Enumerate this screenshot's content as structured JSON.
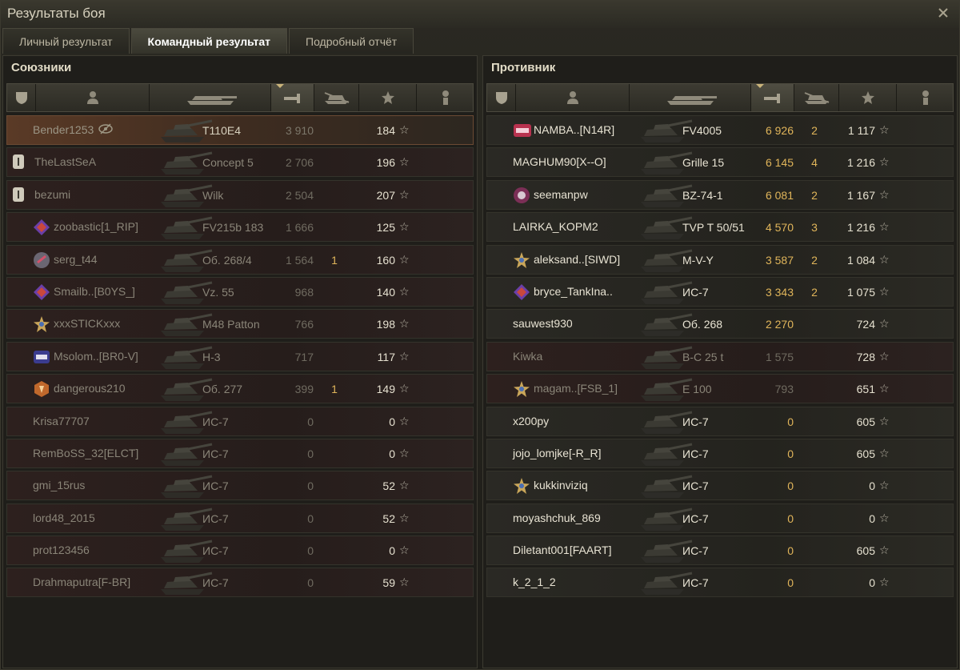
{
  "window": {
    "title": "Результаты боя"
  },
  "tabs": [
    {
      "label": "Личный результат",
      "active": false
    },
    {
      "label": "Командный результат",
      "active": true
    },
    {
      "label": "Подробный отчёт",
      "active": false
    }
  ],
  "allies": {
    "title": "Союзники",
    "rows": [
      {
        "name": "Bender1253",
        "vehicle": "T110E4",
        "damage": "3 910",
        "kills": "",
        "xp": "184",
        "state": "me",
        "badge": "none",
        "vision_icon": true
      },
      {
        "name": "TheLastSeA",
        "vehicle": "Concept 5",
        "damage": "2 706",
        "kills": "",
        "xp": "196",
        "state": "dead",
        "badge": "platoon"
      },
      {
        "name": "bezumi",
        "vehicle": "Wilk",
        "damage": "2 504",
        "kills": "",
        "xp": "207",
        "state": "dead",
        "badge": "platoon"
      },
      {
        "name": "zoobastic[1_RIP]",
        "vehicle": "FV215b 183",
        "damage": "1 666",
        "kills": "",
        "xp": "125",
        "state": "dead",
        "badge": "clan-purple"
      },
      {
        "name": "serg_t44",
        "vehicle": "Об. 268/4",
        "damage": "1 564",
        "kills": "1",
        "xp": "160",
        "state": "dead",
        "badge": "clan-gray"
      },
      {
        "name": "Smailb..[B0YS_]",
        "vehicle": "Vz. 55",
        "damage": "968",
        "kills": "",
        "xp": "140",
        "state": "dead",
        "badge": "clan-purple"
      },
      {
        "name": "xxxSTICKxxx",
        "vehicle": "M48 Patton",
        "damage": "766",
        "kills": "",
        "xp": "198",
        "state": "dead",
        "badge": "clan-star"
      },
      {
        "name": "Msolom..[BR0-V]",
        "vehicle": "Н-3",
        "damage": "717",
        "kills": "",
        "xp": "117",
        "state": "dead",
        "badge": "clan-jove"
      },
      {
        "name": "dangerous210",
        "vehicle": "Об. 277",
        "damage": "399",
        "kills": "1",
        "xp": "149",
        "state": "dead",
        "badge": "clan-orange"
      },
      {
        "name": "Krisa77707",
        "vehicle": "ИС-7",
        "damage": "0",
        "kills": "",
        "xp": "0",
        "state": "dead",
        "badge": "none"
      },
      {
        "name": "RemBoSS_32[ELCT]",
        "vehicle": "ИС-7",
        "damage": "0",
        "kills": "",
        "xp": "0",
        "state": "dead",
        "badge": "none"
      },
      {
        "name": "gmi_15rus",
        "vehicle": "ИС-7",
        "damage": "0",
        "kills": "",
        "xp": "52",
        "state": "dead",
        "badge": "none"
      },
      {
        "name": "lord48_2015",
        "vehicle": "ИС-7",
        "damage": "0",
        "kills": "",
        "xp": "52",
        "state": "dead",
        "badge": "none"
      },
      {
        "name": "prot123456",
        "vehicle": "ИС-7",
        "damage": "0",
        "kills": "",
        "xp": "0",
        "state": "dead",
        "badge": "none"
      },
      {
        "name": "Drahmaputra[F-BR]",
        "vehicle": "ИС-7",
        "damage": "0",
        "kills": "",
        "xp": "59",
        "state": "dead",
        "badge": "none"
      }
    ]
  },
  "enemies": {
    "title": "Противник",
    "rows": [
      {
        "name": "NAMBA..[N14R]",
        "vehicle": "FV4005",
        "damage": "6 926",
        "kills": "2",
        "xp": "1 117",
        "state": "alive",
        "badge": "clan-nerf"
      },
      {
        "name": "MAGHUM90[X--O]",
        "vehicle": "Grille 15",
        "damage": "6 145",
        "kills": "4",
        "xp": "1 216",
        "state": "alive",
        "badge": "none"
      },
      {
        "name": "seemanpw",
        "vehicle": "BZ-74-1",
        "damage": "6 081",
        "kills": "2",
        "xp": "1 167",
        "state": "alive",
        "badge": "clan-pink"
      },
      {
        "name": "LAIRKA_KOPM2",
        "vehicle": "TVP T 50/51",
        "damage": "4 570",
        "kills": "3",
        "xp": "1 216",
        "state": "alive",
        "badge": "none"
      },
      {
        "name": "aleksand..[SIWD]",
        "vehicle": "M-V-Y",
        "damage": "3 587",
        "kills": "2",
        "xp": "1 084",
        "state": "alive",
        "badge": "clan-star"
      },
      {
        "name": "bryce_TankIna..",
        "vehicle": "ИС-7",
        "damage": "3 343",
        "kills": "2",
        "xp": "1 075",
        "state": "alive",
        "badge": "clan-purple"
      },
      {
        "name": "sauwest930",
        "vehicle": "Об. 268",
        "damage": "2 270",
        "kills": "",
        "xp": "724",
        "state": "alive",
        "badge": "none"
      },
      {
        "name": "Kiwka",
        "vehicle": "B-C 25 t",
        "damage": "1 575",
        "kills": "",
        "xp": "728",
        "state": "dead",
        "badge": "none"
      },
      {
        "name": "magam..[FSB_1]",
        "vehicle": "E 100",
        "damage": "793",
        "kills": "",
        "xp": "651",
        "state": "dead",
        "badge": "clan-star"
      },
      {
        "name": "x200py",
        "vehicle": "ИС-7",
        "damage": "0",
        "kills": "",
        "xp": "605",
        "state": "alive",
        "badge": "none"
      },
      {
        "name": "jojo_lomjke[-R_R]",
        "vehicle": "ИС-7",
        "damage": "0",
        "kills": "",
        "xp": "605",
        "state": "alive",
        "badge": "none"
      },
      {
        "name": "kukkinviziq",
        "vehicle": "ИС-7",
        "damage": "0",
        "kills": "",
        "xp": "0",
        "state": "alive",
        "badge": "clan-star"
      },
      {
        "name": "moyashchuk_869",
        "vehicle": "ИС-7",
        "damage": "0",
        "kills": "",
        "xp": "0",
        "state": "alive",
        "badge": "none"
      },
      {
        "name": "Diletant001[FAART]",
        "vehicle": "ИС-7",
        "damage": "0",
        "kills": "",
        "xp": "605",
        "state": "alive",
        "badge": "none"
      },
      {
        "name": "k_2_1_2",
        "vehicle": "ИС-7",
        "damage": "0",
        "kills": "",
        "xp": "0",
        "state": "alive",
        "badge": "none"
      }
    ]
  },
  "colors": {
    "gold": "#e0b55a",
    "panel": "#1f1e1a",
    "highlight": "#5a3a26"
  }
}
